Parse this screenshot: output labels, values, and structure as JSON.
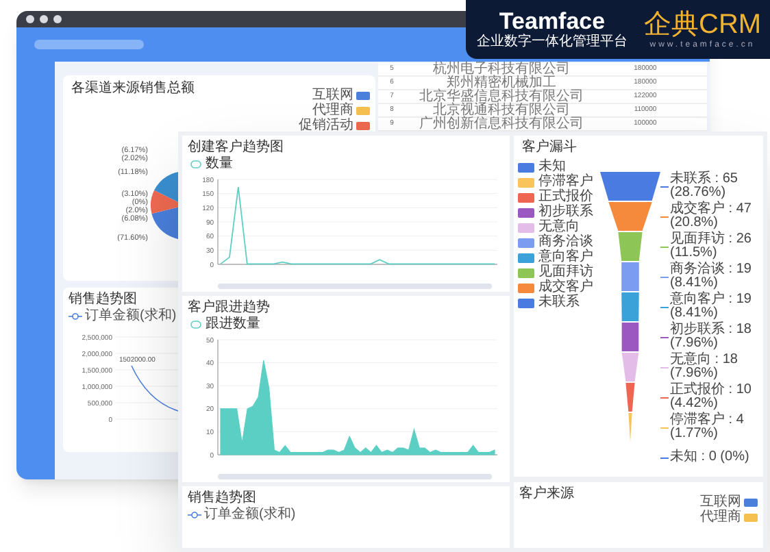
{
  "back_window": {
    "pie_panel": {
      "title": "各渠道来源销售总额",
      "legend": [
        {
          "label": "互联网",
          "color": "#4a7fdc"
        },
        {
          "label": "代理商",
          "color": "#f5c050"
        },
        {
          "label": "促销活动",
          "color": "#ee6a50"
        }
      ],
      "slice_labels": [
        "(6.17%)",
        "(2.02%)",
        "(11.18%)",
        "(3.10%)",
        "(0%)",
        "(2.0%)",
        "(6.08%)",
        "(71.60%)"
      ]
    },
    "ranking_table": {
      "rows": [
        {
          "rank": "5",
          "name": "杭州电子科技有限公司",
          "amount": "180000"
        },
        {
          "rank": "6",
          "name": "郑州精密机械加工",
          "amount": "180000"
        },
        {
          "rank": "7",
          "name": "北京华盛信息科技有限公司",
          "amount": "122000"
        },
        {
          "rank": "8",
          "name": "北京视通科技有限公司",
          "amount": "110000"
        },
        {
          "rank": "9",
          "name": "广州创新信息科技有限公司",
          "amount": "100000"
        }
      ]
    },
    "sales_panel": {
      "title": "销售趋势图",
      "legend": "订单金额(求和)",
      "y_tick_labels": [
        "2,500,000",
        "2,000,000",
        "1,500,000",
        "1,000,000",
        "500,000",
        "0"
      ],
      "point_label": "1502000.00"
    }
  },
  "customer_trend": {
    "title": "创建客户趋势图",
    "chart_data": {
      "type": "line",
      "grid": true,
      "yticks": [
        0,
        30,
        60,
        90,
        120,
        150,
        180
      ],
      "ylim": [
        0,
        180
      ],
      "series": [
        {
          "name": "数量",
          "color": "#5ccfc4",
          "values": [
            1,
            15,
            164,
            1,
            1,
            1,
            1,
            5,
            1,
            1,
            1,
            1,
            1,
            1,
            1,
            1,
            1,
            1,
            10,
            1,
            1,
            1,
            1,
            1,
            1,
            1,
            1,
            1,
            1,
            1,
            1,
            1
          ]
        }
      ]
    }
  },
  "follow_trend": {
    "title": "客户跟进趋势",
    "chart_data": {
      "type": "area",
      "grid": true,
      "yticks": [
        0,
        10,
        20,
        30,
        40,
        50
      ],
      "ylim": [
        0,
        50
      ],
      "series": [
        {
          "name": "跟进数量",
          "color": "#5ccfc4",
          "values": [
            20,
            20,
            20,
            20,
            5,
            20,
            21,
            25,
            41,
            29,
            2,
            1,
            4,
            1,
            1,
            1,
            1,
            1,
            1,
            1,
            2,
            2,
            1,
            2,
            8,
            3,
            1,
            3,
            1,
            4,
            1,
            2,
            1,
            3,
            3,
            2,
            11,
            3,
            3,
            1,
            2,
            1,
            1,
            1,
            1,
            1,
            1,
            4,
            1,
            1,
            1,
            2
          ]
        }
      ]
    }
  },
  "funnel": {
    "title": "客户漏斗",
    "legend": [
      {
        "label": "未知",
        "color": "#4a7be0"
      },
      {
        "label": "停滞客户",
        "color": "#f9c55a"
      },
      {
        "label": "正式报价",
        "color": "#ee6651"
      },
      {
        "label": "初步联系",
        "color": "#9a58c0"
      },
      {
        "label": "无意向",
        "color": "#e3bde8"
      },
      {
        "label": "商务洽谈",
        "color": "#7b9cf0"
      },
      {
        "label": "意向客户",
        "color": "#3ba2d9"
      },
      {
        "label": "见面拜访",
        "color": "#8dc556"
      },
      {
        "label": "成交客户",
        "color": "#f58a3c"
      },
      {
        "label": "未联系",
        "color": "#4a7be0"
      }
    ],
    "stages": [
      {
        "label": "未联系 : 65 (28.76%)",
        "color": "#4a7be0"
      },
      {
        "label": "成交客户 : 47 (20.8%)",
        "color": "#f58a3c"
      },
      {
        "label": "见面拜访 : 26 (11.5%)",
        "color": "#8dc556"
      },
      {
        "label": "商务洽谈 : 19 (8.41%)",
        "color": "#7b9cf0"
      },
      {
        "label": "意向客户 : 19 (8.41%)",
        "color": "#3ba2d9"
      },
      {
        "label": "初步联系 : 18 (7.96%)",
        "color": "#9a58c0"
      },
      {
        "label": "无意向 : 18 (7.96%)",
        "color": "#e3bde8"
      },
      {
        "label": "正式报价 : 10 (4.42%)",
        "color": "#ee6651"
      },
      {
        "label": "停滞客户 : 4 (1.77%)",
        "color": "#f9c55a"
      },
      {
        "label": "未知 : 0 (0%)",
        "color": "#4a7be0"
      }
    ]
  },
  "sales_trend": {
    "title": "销售趋势图",
    "legend": "订单金额(求和)"
  },
  "customer_source": {
    "title": "客户来源",
    "legend": [
      {
        "label": "互联网",
        "color": "#4a7fdc"
      },
      {
        "label": "代理商",
        "color": "#f5c050"
      }
    ]
  },
  "brand_banner": {
    "name": "Teamface",
    "tagline": "企业数字一体化管理平台",
    "product": "企典CRM",
    "url": "www.teamface.cn"
  }
}
